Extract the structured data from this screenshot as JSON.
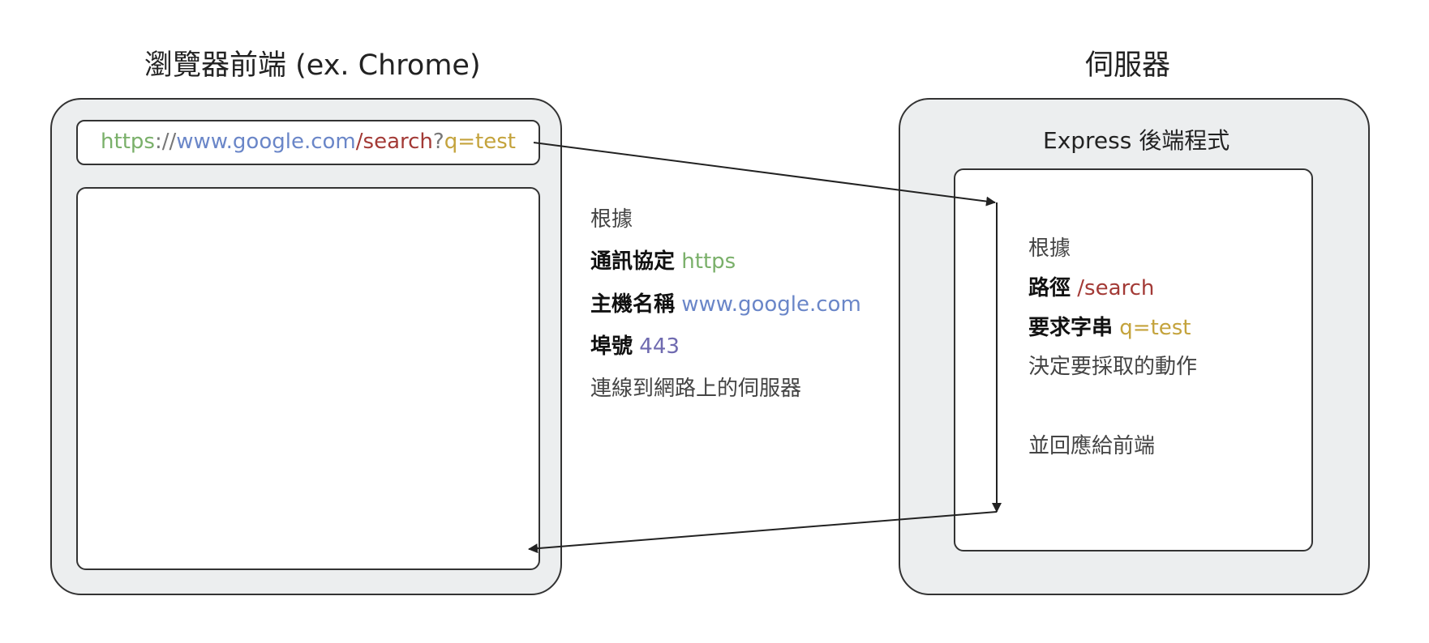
{
  "browser": {
    "title": "瀏覽器前端 (ex. Chrome)",
    "url": {
      "scheme": "https",
      "sep": "://",
      "host": "www.google.com",
      "path": "/search",
      "qmark": "?",
      "query": "q=test"
    }
  },
  "middle": {
    "intro": "根據",
    "protocol_label": "通訊協定",
    "protocol_value": "https",
    "host_label": "主機名稱",
    "host_value": "www.google.com",
    "port_label": "埠號",
    "port_value": "443",
    "action": "連線到網路上的伺服器"
  },
  "server": {
    "title": "伺服器",
    "app_label": "Express 後端程式",
    "intro": "根據",
    "path_label": "路徑",
    "path_value": "/search",
    "query_label": "要求字串",
    "query_value": "q=test",
    "decide": "決定要採取的動作",
    "respond": "並回應給前端"
  },
  "colors": {
    "scheme": "#7ab06a",
    "host": "#6a86c8",
    "path": "#a33a36",
    "query": "#c4a33c",
    "port": "#6f6ab0",
    "box_fill": "#eceeef",
    "stroke": "#333333"
  }
}
